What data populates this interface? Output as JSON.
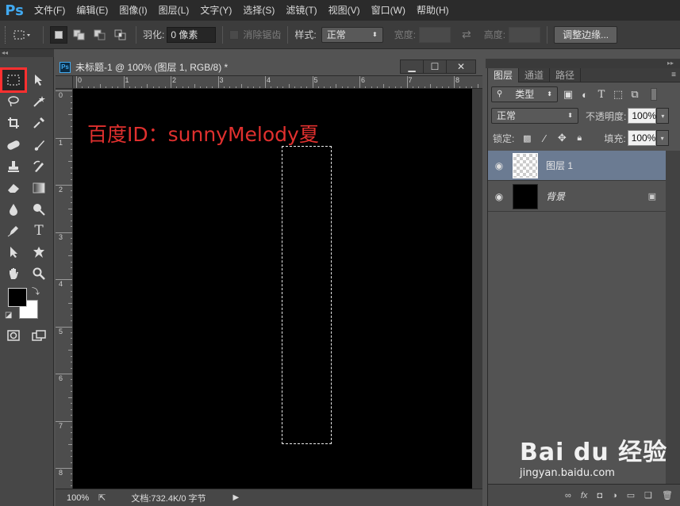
{
  "app": {
    "logo": "Ps",
    "menu": [
      "文件(F)",
      "编辑(E)",
      "图像(I)",
      "图层(L)",
      "文字(Y)",
      "选择(S)",
      "滤镜(T)",
      "视图(V)",
      "窗口(W)",
      "帮助(H)"
    ]
  },
  "options": {
    "feather_label": "羽化:",
    "feather_value": "0 像素",
    "antialias_label": "消除锯齿",
    "style_label": "样式:",
    "style_value": "正常",
    "width_label": "宽度:",
    "height_label": "高度:",
    "refine_edge_label": "调整边缘..."
  },
  "document": {
    "title": "未标题-1 @ 100% (图层 1, RGB/8) *",
    "min": "▁",
    "max": "☐",
    "close": "✕",
    "ruler_h": [
      "0",
      "1",
      "2",
      "3",
      "4",
      "5",
      "6",
      "7",
      "8"
    ],
    "ruler_v": [
      "0",
      "1",
      "2",
      "3",
      "4",
      "5",
      "6",
      "7",
      "8"
    ],
    "watermark_text": "百度ID：sunnyMelody夏",
    "zoom": "100%",
    "doc_info": "文档:732.4K/0 字节"
  },
  "panel": {
    "tabs": [
      "图层",
      "通道",
      "路径"
    ],
    "filter_kind": "类型",
    "blend_mode": "正常",
    "opacity_label": "不透明度:",
    "opacity_value": "100%",
    "lock_label": "锁定:",
    "fill_label": "填充:",
    "fill_value": "100%",
    "layers": [
      {
        "name": "图层 1",
        "visible": true,
        "selected": true
      },
      {
        "name": "背景",
        "visible": true,
        "selected": false,
        "locked": true
      }
    ]
  },
  "overlay": {
    "brand": "Bai du 经验",
    "url": "jingyan.baidu.com"
  },
  "colors": {
    "foreground": "#000000",
    "background": "#ffffff",
    "highlight": "#ff3030",
    "watermark": "#e0302e"
  }
}
